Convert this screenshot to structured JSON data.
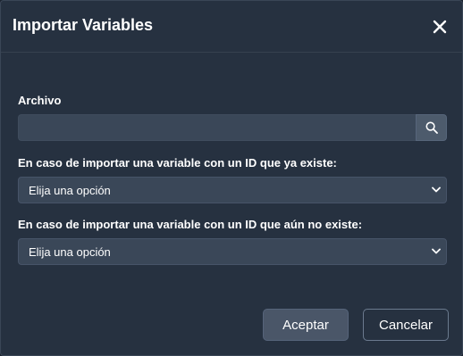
{
  "dialog": {
    "title": "Importar Variables",
    "close_icon": "close-icon"
  },
  "file_field": {
    "label": "Archivo",
    "value": "",
    "placeholder": "",
    "search_icon": "search-icon"
  },
  "existing_id_field": {
    "label": "En caso de importar una variable con un ID que ya existe:",
    "selected": "Elija una opción"
  },
  "new_id_field": {
    "label": "En caso de importar una variable con un ID que aún no existe:",
    "selected": "Elija una opción"
  },
  "buttons": {
    "accept": "Aceptar",
    "cancel": "Cancelar"
  },
  "colors": {
    "dialog_background": "#263140",
    "input_background": "#3a4758",
    "button_accept": "#4a5668",
    "text": "#ffffff"
  }
}
